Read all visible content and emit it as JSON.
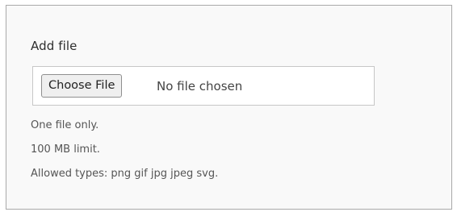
{
  "field": {
    "label": "Add file",
    "button_label": "Choose File",
    "status_text": "No file chosen"
  },
  "help": {
    "line1": "One file only.",
    "line2": "100 MB limit.",
    "line3": "Allowed types: png gif jpg jpeg svg."
  }
}
